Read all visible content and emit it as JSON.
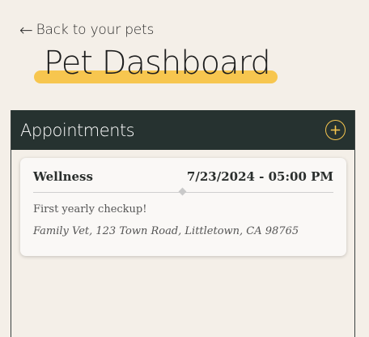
{
  "nav": {
    "back_arrow": "←",
    "back_label": "Back to your pets"
  },
  "header": {
    "title": "Pet Dashboard"
  },
  "appointments": {
    "title": "Appointments",
    "add_icon": "plus-circle-icon",
    "items": [
      {
        "type": "Wellness",
        "datetime": "7/23/2024 - 05:00 PM",
        "note": "First yearly checkup!",
        "location": "Family Vet, 123 Town Road, Littletown, CA 98765"
      }
    ]
  },
  "colors": {
    "background": "#f4efe8",
    "header_bg": "#263230",
    "accent": "#f7c64f",
    "card_bg": "#faf8f6",
    "text": "#2b2f2d"
  }
}
